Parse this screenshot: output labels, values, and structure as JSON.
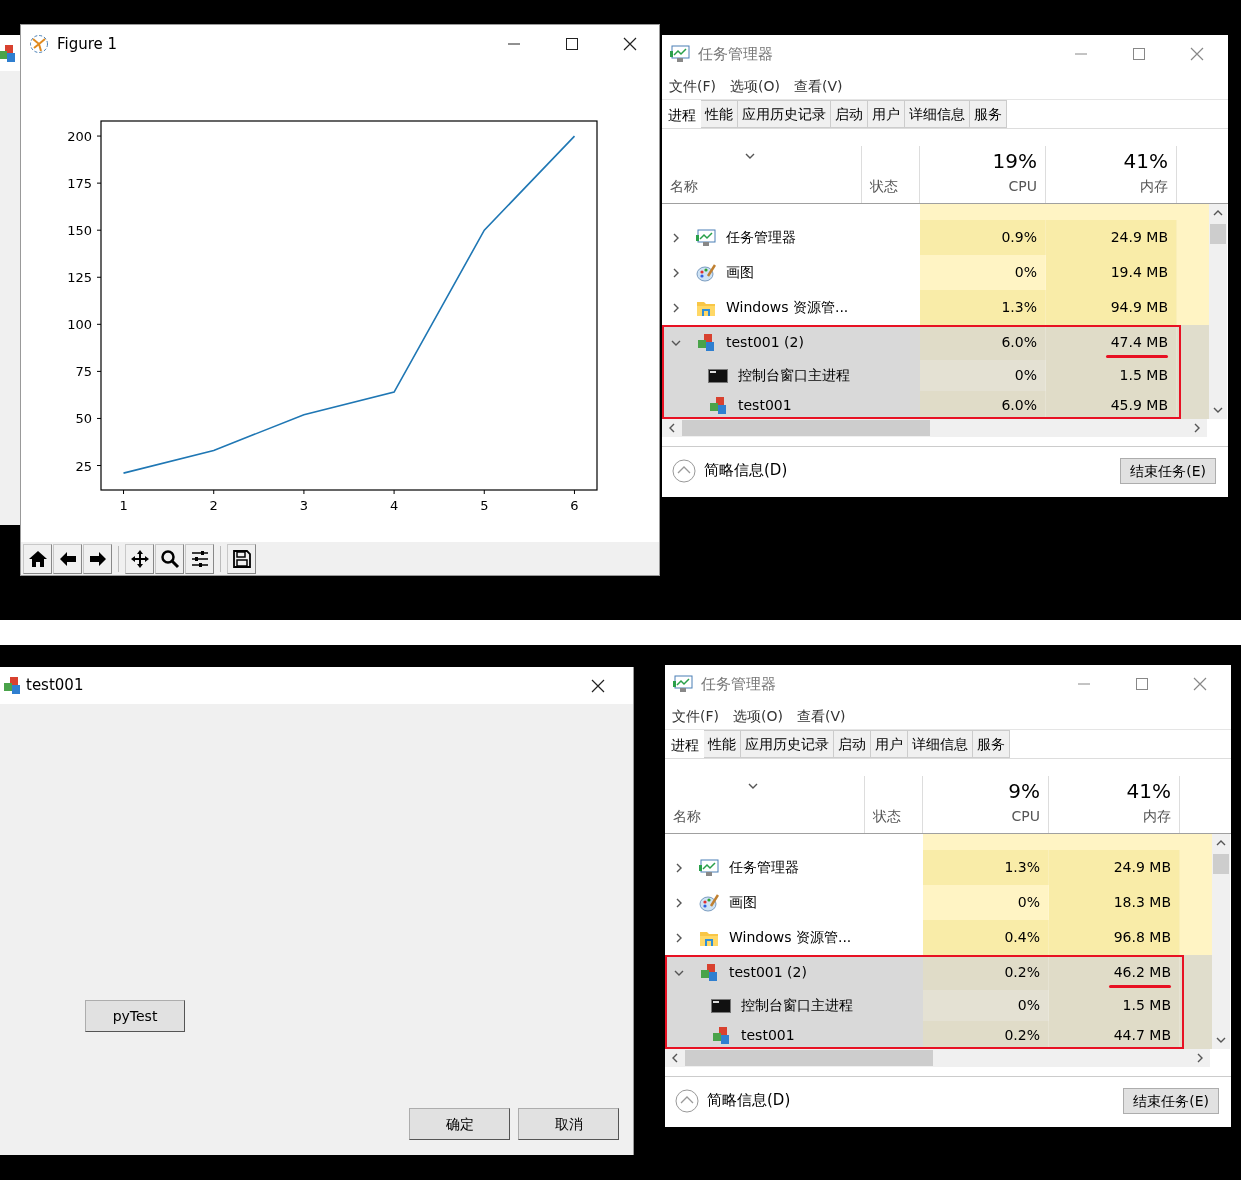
{
  "top_screen": {
    "background_window": {
      "kind": "window"
    },
    "figure_window": {
      "title": "Figure 1",
      "chart_data": {
        "type": "line",
        "x": [
          1,
          2,
          3,
          4,
          5,
          6
        ],
        "series": [
          {
            "color": "#1f77b4",
            "values": [
              21,
              33,
              52,
              64,
              150,
              200
            ]
          }
        ],
        "xlim": [
          0.75,
          6.25
        ],
        "ylim": [
          12,
          208
        ],
        "xticks": [
          1,
          2,
          3,
          4,
          5,
          6
        ],
        "yticks": [
          25,
          50,
          75,
          100,
          125,
          150,
          175,
          200
        ]
      },
      "toolbar": [
        {
          "kind": "home"
        },
        {
          "kind": "back"
        },
        {
          "kind": "forward"
        },
        {
          "kind": "separator"
        },
        {
          "kind": "pan"
        },
        {
          "kind": "zoom"
        },
        {
          "kind": "configure"
        },
        {
          "kind": "separator"
        },
        {
          "kind": "save"
        }
      ]
    },
    "task_manager": {
      "title": "任务管理器",
      "menus": [
        {
          "label": "文件(F)"
        },
        {
          "label": "选项(O)"
        },
        {
          "label": "查看(V)"
        }
      ],
      "tabs": [
        {
          "label": "进程",
          "selected": true
        },
        {
          "label": "性能",
          "selected": false
        },
        {
          "label": "应用历史记录",
          "selected": false
        },
        {
          "label": "启动",
          "selected": false
        },
        {
          "label": "用户",
          "selected": false
        },
        {
          "label": "详细信息",
          "selected": false
        },
        {
          "label": "服务",
          "selected": false
        }
      ],
      "columns": {
        "name": "名称",
        "status": "状态",
        "cpu": {
          "total": "19%",
          "label": "CPU"
        },
        "memory": {
          "total": "41%",
          "label": "内存"
        }
      },
      "rows": [
        {
          "kind": "taskmgr",
          "name": "任务管理器",
          "expanded": false,
          "selected": false,
          "boxed": false,
          "cpu": {
            "text": "0.9%",
            "color": "#f9eca8"
          },
          "memory": {
            "text": "24.9 MB",
            "color": "#f9eca8",
            "underlined": false
          }
        },
        {
          "kind": "paint",
          "name": "画图",
          "expanded": false,
          "selected": false,
          "boxed": false,
          "cpu": {
            "text": "0%",
            "color": "#fff4c4"
          },
          "memory": {
            "text": "19.4 MB",
            "color": "#f9eca8",
            "underlined": false
          }
        },
        {
          "kind": "explorer",
          "name": "Windows 资源管...",
          "expanded": false,
          "selected": false,
          "boxed": false,
          "cpu": {
            "text": "1.3%",
            "color": "#f9eca8"
          },
          "memory": {
            "text": "94.9 MB",
            "color": "#f9eca8",
            "underlined": false
          }
        },
        {
          "kind": "mfc",
          "name": "test001 (2)",
          "expanded": true,
          "selected": true,
          "boxed": true,
          "cpu": {
            "text": "6.0%",
            "color": "#e0dcc8"
          },
          "memory": {
            "text": "47.4 MB",
            "color": "#e0dcc8",
            "underlined": true
          },
          "children": [
            {
              "kind": "console",
              "name": "控制台窗口主进程",
              "cpu": {
                "text": "0%",
                "color": "#e4e1d3"
              },
              "memory": {
                "text": "1.5 MB",
                "color": "#e0dcc8"
              }
            },
            {
              "kind": "mfc",
              "name": "test001",
              "cpu": {
                "text": "6.0%",
                "color": "#e0dcc8"
              },
              "memory": {
                "text": "45.9 MB",
                "color": "#e0dcc8"
              }
            }
          ]
        }
      ],
      "footer": {
        "details": "简略信息(D)",
        "end_task": "结束任务(E)"
      }
    }
  },
  "bottom_screen": {
    "dialog_window": {
      "title": "test001",
      "buttons": [
        {
          "label": "pyTest",
          "kind": "action"
        },
        {
          "label": "确定",
          "kind": "ok"
        },
        {
          "label": "取消",
          "kind": "cancel"
        }
      ]
    },
    "task_manager": {
      "title": "任务管理器",
      "menus": [
        {
          "label": "文件(F)"
        },
        {
          "label": "选项(O)"
        },
        {
          "label": "查看(V)"
        }
      ],
      "tabs": [
        {
          "label": "进程",
          "selected": true
        },
        {
          "label": "性能",
          "selected": false
        },
        {
          "label": "应用历史记录",
          "selected": false
        },
        {
          "label": "启动",
          "selected": false
        },
        {
          "label": "用户",
          "selected": false
        },
        {
          "label": "详细信息",
          "selected": false
        },
        {
          "label": "服务",
          "selected": false
        }
      ],
      "columns": {
        "name": "名称",
        "status": "状态",
        "cpu": {
          "total": "9%",
          "label": "CPU"
        },
        "memory": {
          "total": "41%",
          "label": "内存"
        }
      },
      "rows": [
        {
          "kind": "taskmgr",
          "name": "任务管理器",
          "expanded": false,
          "selected": false,
          "boxed": false,
          "cpu": {
            "text": "1.3%",
            "color": "#f9eca8"
          },
          "memory": {
            "text": "24.9 MB",
            "color": "#f9eca8",
            "underlined": false
          }
        },
        {
          "kind": "paint",
          "name": "画图",
          "expanded": false,
          "selected": false,
          "boxed": false,
          "cpu": {
            "text": "0%",
            "color": "#fff4c4"
          },
          "memory": {
            "text": "18.3 MB",
            "color": "#f9eca8",
            "underlined": false
          }
        },
        {
          "kind": "explorer",
          "name": "Windows 资源管...",
          "expanded": false,
          "selected": false,
          "boxed": false,
          "cpu": {
            "text": "0.4%",
            "color": "#f9eca8"
          },
          "memory": {
            "text": "96.8 MB",
            "color": "#f9eca8",
            "underlined": false
          }
        },
        {
          "kind": "mfc",
          "name": "test001 (2)",
          "expanded": true,
          "selected": true,
          "boxed": true,
          "cpu": {
            "text": "0.2%",
            "color": "#e0dcc8"
          },
          "memory": {
            "text": "46.2 MB",
            "color": "#e0dcc8",
            "underlined": true
          },
          "children": [
            {
              "kind": "console",
              "name": "控制台窗口主进程",
              "cpu": {
                "text": "0%",
                "color": "#e4e1d3"
              },
              "memory": {
                "text": "1.5 MB",
                "color": "#e0dcc8"
              }
            },
            {
              "kind": "mfc",
              "name": "test001",
              "cpu": {
                "text": "0.2%",
                "color": "#e0dcc8"
              },
              "memory": {
                "text": "44.7 MB",
                "color": "#e0dcc8"
              }
            }
          ]
        }
      ],
      "footer": {
        "details": "简略信息(D)",
        "end_task": "结束任务(E)"
      }
    }
  }
}
